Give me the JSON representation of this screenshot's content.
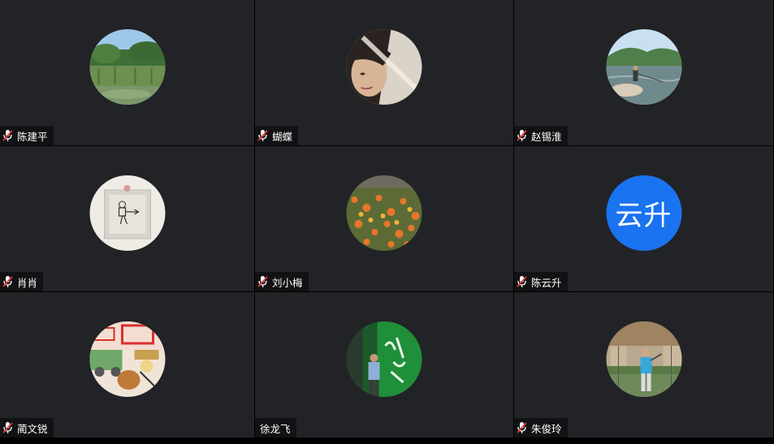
{
  "participants": [
    {
      "name": "陈建平",
      "muted": true,
      "avatar": "photo-lake-reeds"
    },
    {
      "name": "蝴蝶",
      "muted": true,
      "avatar": "photo-woman-portrait"
    },
    {
      "name": "赵锡淮",
      "muted": true,
      "avatar": "photo-river-fishing"
    },
    {
      "name": "肖肖",
      "muted": true,
      "avatar": "photo-framed-sketch"
    },
    {
      "name": "刘小梅",
      "muted": true,
      "avatar": "photo-orange-flowers"
    },
    {
      "name": "陈云升",
      "muted": true,
      "avatar": "text-avatar",
      "avatar_text": "云升",
      "avatar_color": "#1a73f0"
    },
    {
      "name": "蔺文锐",
      "muted": true,
      "avatar": "photo-child-drawing"
    },
    {
      "name": "徐龙飞",
      "muted": false,
      "avatar": "photo-man-green-sign"
    },
    {
      "name": "朱俊玲",
      "muted": true,
      "avatar": "photo-badminton-player"
    }
  ],
  "colors": {
    "tile_bg": "#222326",
    "nameplate_bg": "#121214",
    "mic_muted": "#e03b3b"
  }
}
